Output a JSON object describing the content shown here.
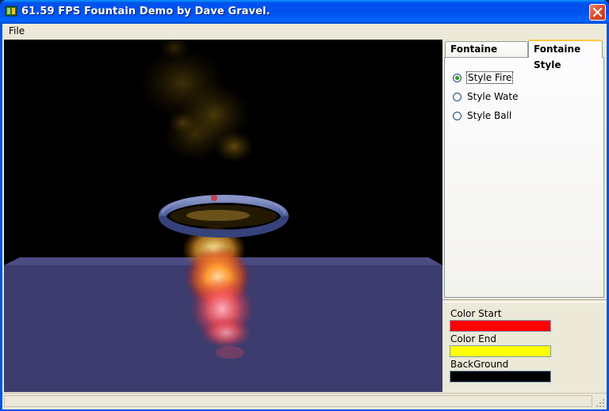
{
  "window": {
    "title": "61.59 FPS Fountain Demo by Dave Gravel.",
    "app_icon": "app-icon",
    "close_icon": "close-icon"
  },
  "menu": {
    "items": [
      {
        "label": "File"
      }
    ]
  },
  "viewport": {
    "background_color": "#000000",
    "floor_color": "#3c3d6e",
    "ring_color": "#4a5a96",
    "scene": "fire-fountain"
  },
  "tabs": [
    {
      "label": "Fontaine Setting",
      "active": false
    },
    {
      "label": "Fontaine Style",
      "active": true
    }
  ],
  "style_options": [
    {
      "label": "Style Fire",
      "checked": true
    },
    {
      "label": "Style Wate",
      "checked": false
    },
    {
      "label": "Style Ball",
      "checked": false
    }
  ],
  "colors": {
    "start": {
      "label": "Color Start",
      "value": "#ff0000"
    },
    "end": {
      "label": "Color End",
      "value": "#ffff00"
    },
    "background": {
      "label": "BackGround",
      "value": "#000000"
    }
  },
  "status": {
    "text": ""
  }
}
